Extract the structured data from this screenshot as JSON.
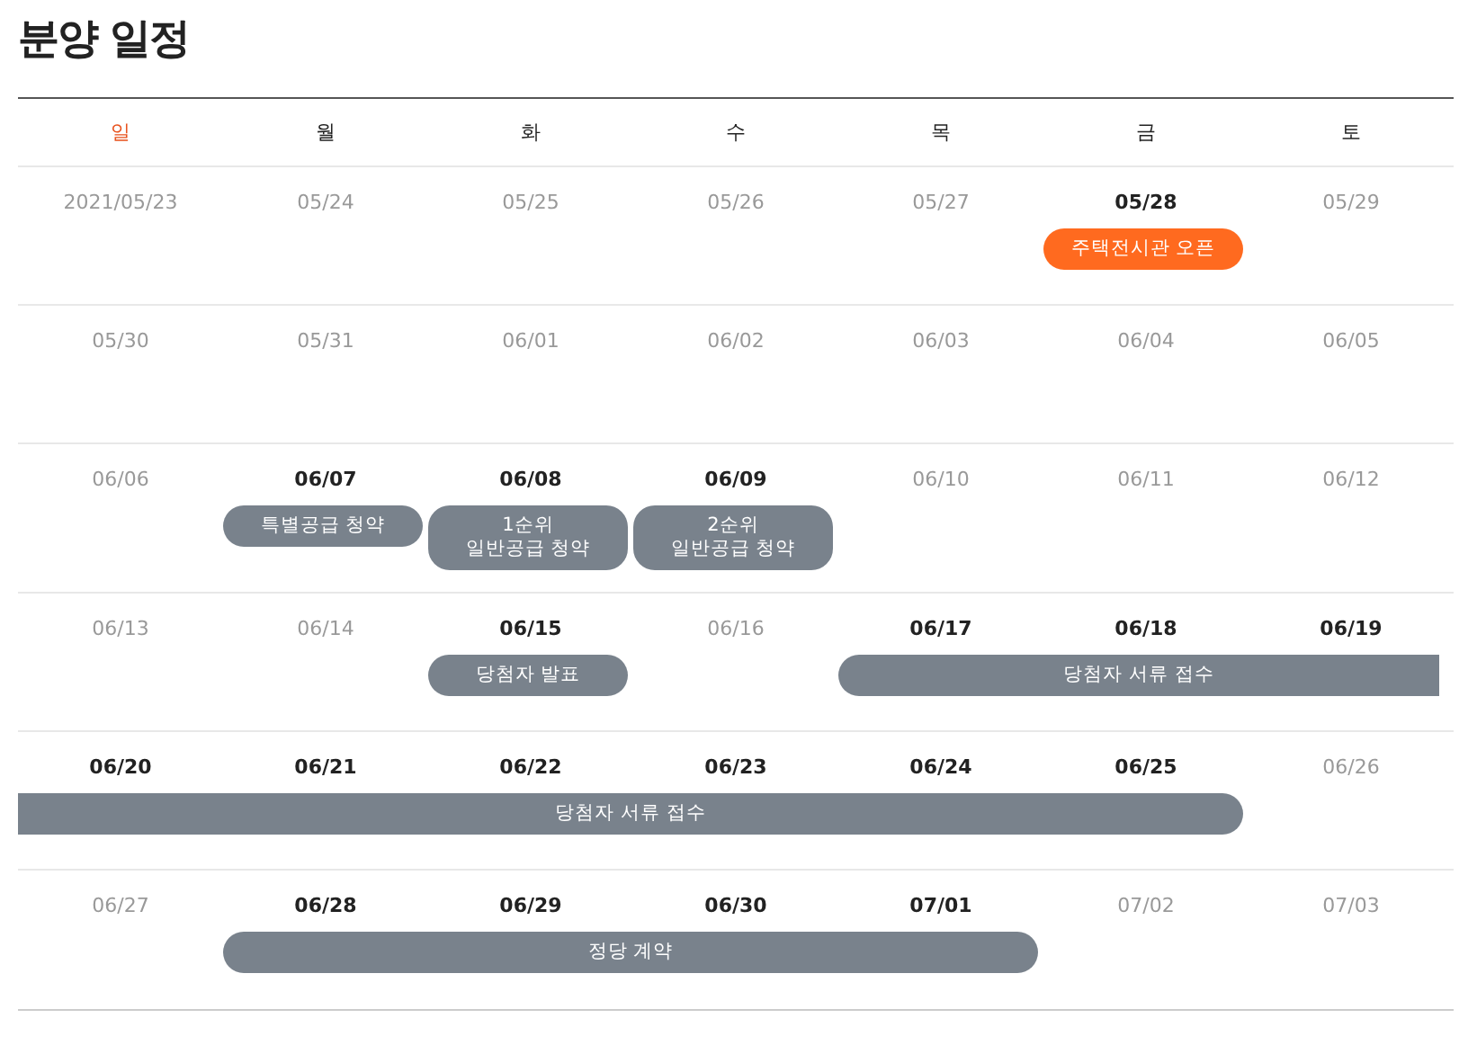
{
  "title": "분양 일정",
  "weekdays": [
    {
      "label": "일",
      "holiday": true
    },
    {
      "label": "월",
      "holiday": false
    },
    {
      "label": "화",
      "holiday": false
    },
    {
      "label": "수",
      "holiday": false
    },
    {
      "label": "목",
      "holiday": false
    },
    {
      "label": "금",
      "holiday": false
    },
    {
      "label": "토",
      "holiday": false
    }
  ],
  "weeks": [
    {
      "cells": [
        {
          "days": [
            {
              "date": "2021/05/23",
              "active": false
            }
          ]
        },
        {
          "days": [
            {
              "date": "05/24",
              "active": false
            }
          ]
        },
        {
          "days": [
            {
              "date": "05/25",
              "active": false
            }
          ]
        },
        {
          "days": [
            {
              "date": "05/26",
              "active": false
            }
          ]
        },
        {
          "days": [
            {
              "date": "05/27",
              "active": false
            }
          ]
        },
        {
          "days": [
            {
              "date": "05/28",
              "active": true
            }
          ],
          "event": {
            "label": "주택전시관 오픈",
            "color": "#ff6a1f",
            "continues_before": false,
            "continues_after": false
          }
        },
        {
          "days": [
            {
              "date": "05/29",
              "active": false
            }
          ]
        }
      ]
    },
    {
      "cells": [
        {
          "days": [
            {
              "date": "05/30",
              "active": false
            }
          ]
        },
        {
          "days": [
            {
              "date": "05/31",
              "active": false
            }
          ]
        },
        {
          "days": [
            {
              "date": "06/01",
              "active": false
            }
          ]
        },
        {
          "days": [
            {
              "date": "06/02",
              "active": false
            }
          ]
        },
        {
          "days": [
            {
              "date": "06/03",
              "active": false
            }
          ]
        },
        {
          "days": [
            {
              "date": "06/04",
              "active": false
            }
          ]
        },
        {
          "days": [
            {
              "date": "06/05",
              "active": false
            }
          ]
        }
      ]
    },
    {
      "cells": [
        {
          "days": [
            {
              "date": "06/06",
              "active": false
            }
          ]
        },
        {
          "days": [
            {
              "date": "06/07",
              "active": true
            }
          ],
          "event": {
            "label": "특별공급 청약",
            "color": "#79828c",
            "continues_before": false,
            "continues_after": false
          }
        },
        {
          "days": [
            {
              "date": "06/08",
              "active": true
            }
          ],
          "event": {
            "label": "1순위\n일반공급 청약",
            "color": "#79828c",
            "continues_before": false,
            "continues_after": false
          }
        },
        {
          "days": [
            {
              "date": "06/09",
              "active": true
            }
          ],
          "event": {
            "label": "2순위\n일반공급 청약",
            "color": "#79828c",
            "continues_before": false,
            "continues_after": false
          }
        },
        {
          "days": [
            {
              "date": "06/10",
              "active": false
            }
          ]
        },
        {
          "days": [
            {
              "date": "06/11",
              "active": false
            }
          ]
        },
        {
          "days": [
            {
              "date": "06/12",
              "active": false
            }
          ]
        }
      ]
    },
    {
      "cells": [
        {
          "days": [
            {
              "date": "06/13",
              "active": false
            }
          ]
        },
        {
          "days": [
            {
              "date": "06/14",
              "active": false
            }
          ]
        },
        {
          "days": [
            {
              "date": "06/15",
              "active": true
            }
          ],
          "event": {
            "label": "당첨자 발표",
            "color": "#79828c",
            "continues_before": false,
            "continues_after": false
          }
        },
        {
          "days": [
            {
              "date": "06/16",
              "active": false
            }
          ]
        },
        {
          "days": [
            {
              "date": "06/17",
              "active": true
            },
            {
              "date": "06/18",
              "active": true
            },
            {
              "date": "06/19",
              "active": true
            }
          ],
          "event": {
            "label": "당첨자 서류 접수",
            "color": "#79828c",
            "continues_before": false,
            "continues_after": true
          }
        }
      ]
    },
    {
      "cells": [
        {
          "days": [
            {
              "date": "06/20",
              "active": true
            },
            {
              "date": "06/21",
              "active": true
            },
            {
              "date": "06/22",
              "active": true
            },
            {
              "date": "06/23",
              "active": true
            },
            {
              "date": "06/24",
              "active": true
            },
            {
              "date": "06/25",
              "active": true
            }
          ],
          "event": {
            "label": "당첨자 서류 접수",
            "color": "#79828c",
            "continues_before": true,
            "continues_after": false
          }
        },
        {
          "days": [
            {
              "date": "06/26",
              "active": false
            }
          ]
        }
      ]
    },
    {
      "cells": [
        {
          "days": [
            {
              "date": "06/27",
              "active": false
            }
          ]
        },
        {
          "days": [
            {
              "date": "06/28",
              "active": true
            },
            {
              "date": "06/29",
              "active": true
            },
            {
              "date": "06/30",
              "active": true
            },
            {
              "date": "07/01",
              "active": true
            }
          ],
          "event": {
            "label": "정당 계약",
            "color": "#79828c",
            "continues_before": false,
            "continues_after": false
          }
        },
        {
          "days": [
            {
              "date": "07/02",
              "active": false
            }
          ]
        },
        {
          "days": [
            {
              "date": "07/03",
              "active": false
            }
          ]
        }
      ]
    }
  ]
}
